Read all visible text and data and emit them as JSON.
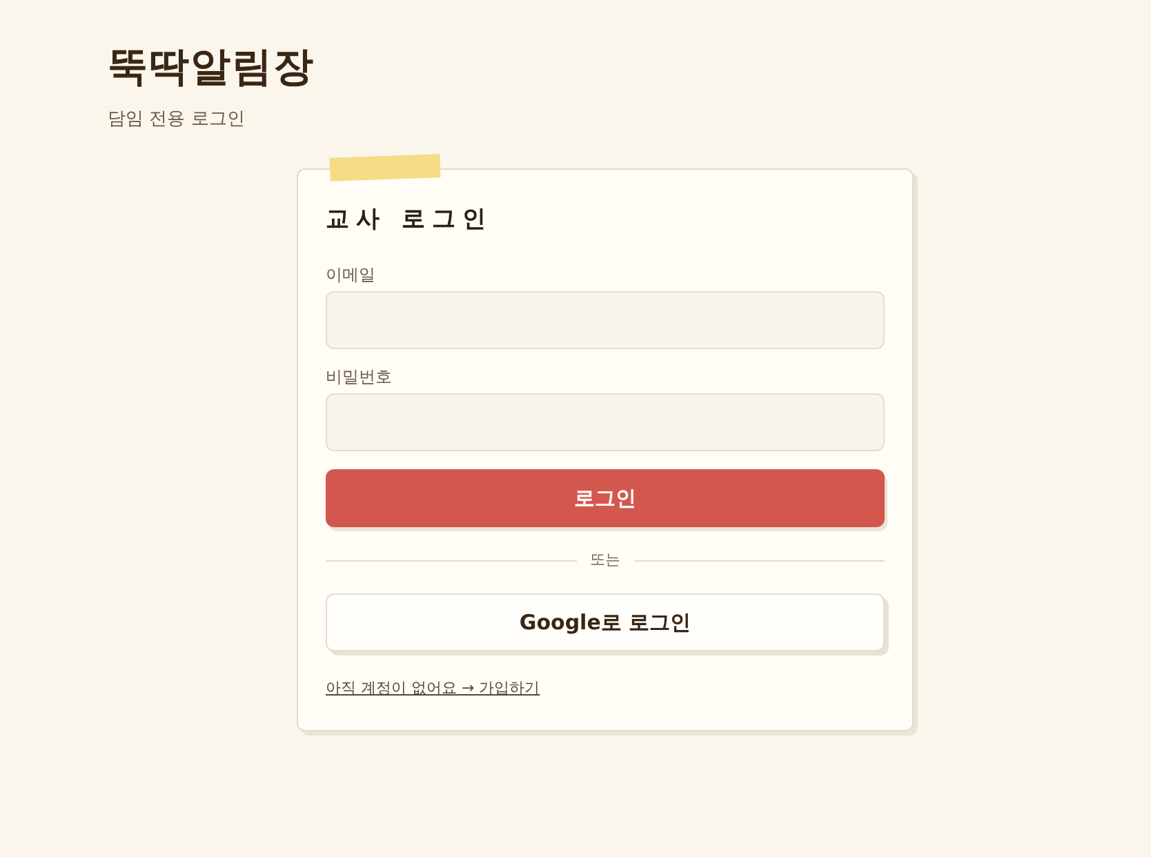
{
  "app": {
    "title": "뚝딱알림장",
    "subtitle": "담임 전용 로그인"
  },
  "login_card": {
    "title": "교사 로그인",
    "fields": [
      {
        "label": "이메일"
      },
      {
        "label": "비밀번호"
      }
    ],
    "submit_button": "로그인",
    "divider_text": "또는",
    "google_button": "Google로 로그인",
    "signup_link": "아직 계정이 없어요 → 가입하기"
  }
}
